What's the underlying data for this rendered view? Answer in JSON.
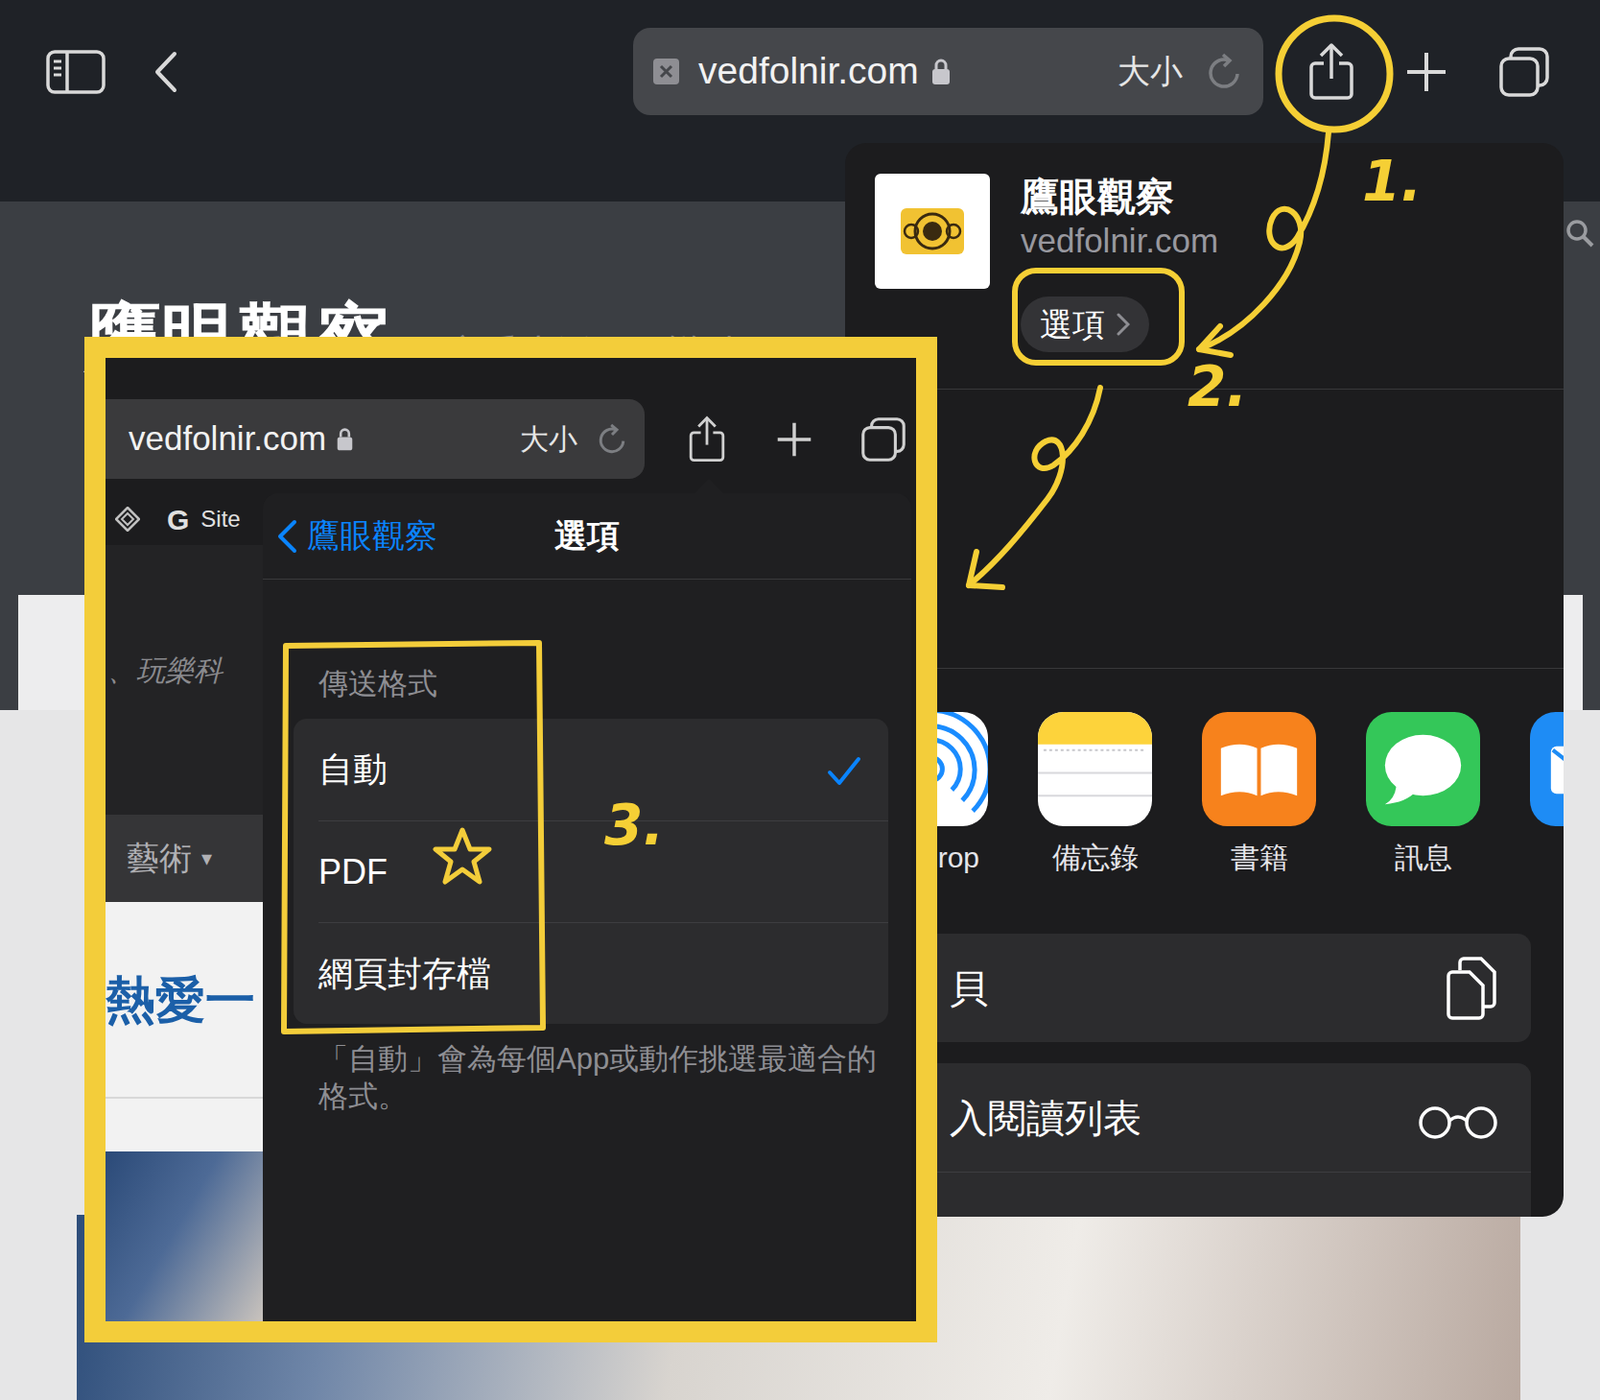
{
  "toolbar": {
    "url": "vedfolnir.com",
    "text_size": "大小"
  },
  "page": {
    "title": "鷹眼觀察",
    "tagline": "享受生活、玩樂科"
  },
  "share_sheet": {
    "title": "鷹眼觀察",
    "subtitle": "vedfolnir.com",
    "options_button": "選項",
    "apps": [
      {
        "label": "rop",
        "kind": "airdrop"
      },
      {
        "label": "備忘錄",
        "kind": "notes"
      },
      {
        "label": "書籍",
        "kind": "books"
      },
      {
        "label": "訊息",
        "kind": "messages"
      },
      {
        "kind": "mail"
      }
    ],
    "actions": [
      {
        "label": "貝",
        "kind": "copy"
      },
      {
        "label": "入閱讀列表",
        "kind": "reading-list"
      }
    ]
  },
  "inset": {
    "toolbar": {
      "url": "vedfolnir.com",
      "text_size": "大小"
    },
    "bookmark_logo": "G",
    "bookmark_label": "Site",
    "page": {
      "tagline": "、玩樂科",
      "menu_item": "藝術",
      "menu_caret": "▾",
      "headline": "熱愛一"
    },
    "options": {
      "back_label": "鷹眼觀察",
      "title": "選項",
      "section": "傳送格式",
      "formats": [
        {
          "label": "自動",
          "selected": true
        },
        {
          "label": "PDF",
          "selected": false
        },
        {
          "label": "網頁封存檔",
          "selected": false
        }
      ],
      "footer": "「自動」會為每個App或動作挑選最適合的格式。"
    }
  },
  "annotations": {
    "steps": [
      "1.",
      "2.",
      "3."
    ]
  }
}
